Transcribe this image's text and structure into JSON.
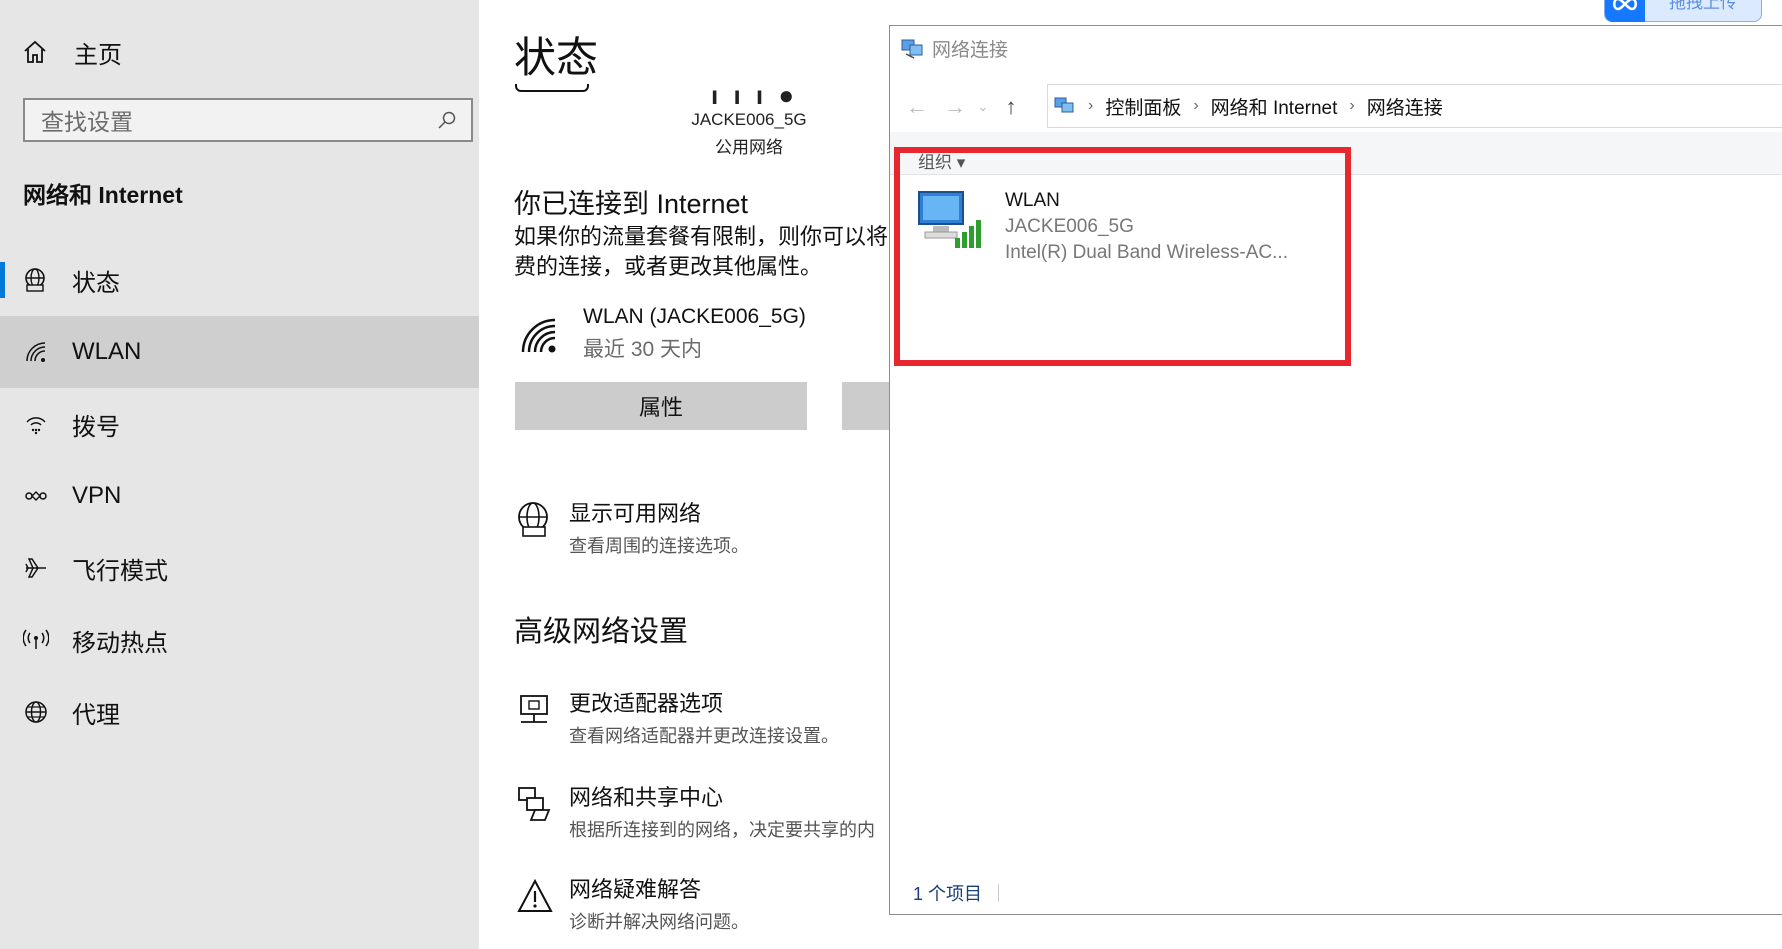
{
  "sidebar": {
    "home_label": "主页",
    "search_placeholder": "查找设置",
    "section_title": "网络和 Internet",
    "items": [
      {
        "label": "状态",
        "icon": "globe-status-icon"
      },
      {
        "label": "WLAN",
        "icon": "wifi-icon"
      },
      {
        "label": "拨号",
        "icon": "dialup-icon"
      },
      {
        "label": "VPN",
        "icon": "vpn-icon"
      },
      {
        "label": "飞行模式",
        "icon": "airplane-icon"
      },
      {
        "label": "移动热点",
        "icon": "hotspot-icon"
      },
      {
        "label": "代理",
        "icon": "globe-icon"
      }
    ]
  },
  "main": {
    "title": "状态",
    "network": {
      "ssid": "JACKE006_5G",
      "type": "公用网络"
    },
    "connected_heading": "你已连接到 Internet",
    "connected_desc_line1": "如果你的流量套餐有限制，则你可以将",
    "connected_desc_line2": "费的连接，或者更改其他属性。",
    "wlan_name": "WLAN (JACKE006_5G)",
    "wlan_usage": "最近 30 天内",
    "properties_button": "属性",
    "show_networks_title": "显示可用网络",
    "show_networks_desc": "查看周围的连接选项。",
    "advanced_heading": "高级网络设置",
    "adapter_title": "更改适配器选项",
    "adapter_desc": "查看网络适配器并更改连接设置。",
    "sharing_title": "网络和共享中心",
    "sharing_desc": "根据所连接到的网络，决定要共享的内",
    "troubleshoot_title": "网络疑难解答",
    "troubleshoot_desc": "诊断并解决网络问题。"
  },
  "explorer": {
    "title": "网络连接",
    "breadcrumb": [
      "控制面板",
      "网络和 Internet",
      "网络连接"
    ],
    "command": "组织 ▾",
    "item": {
      "name": "WLAN",
      "ssid": "JACKE006_5G",
      "adapter": "Intel(R) Dual Band Wireless-AC..."
    },
    "status": "1 个项目",
    "highlight_color": "#e8262d"
  },
  "upload_badge": {
    "label": "拖拽上传"
  },
  "colors": {
    "accent": "#0078d7",
    "sidebar_bg": "#e6e6e6",
    "selected_bg": "#cfcfcf"
  }
}
